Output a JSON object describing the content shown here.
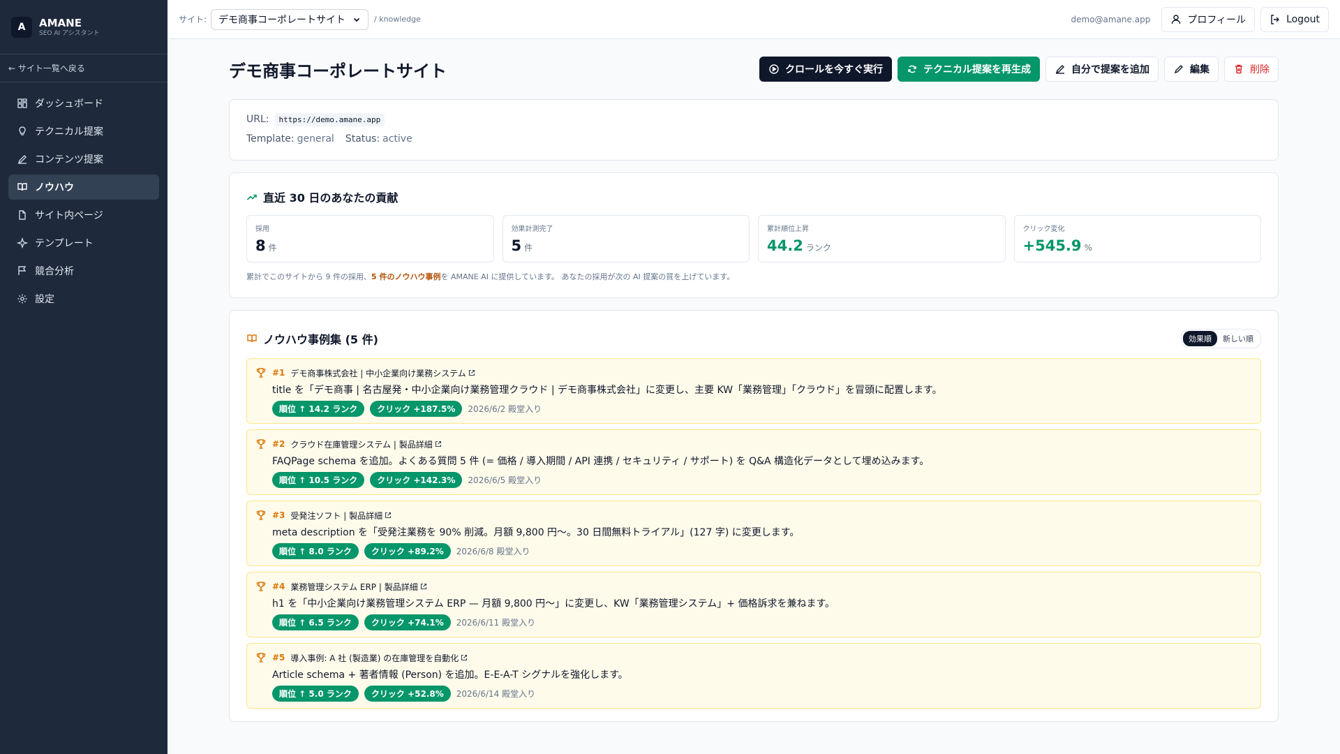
{
  "brand": {
    "logo_letter": "A",
    "name": "AMANE",
    "subtitle": "SEO AI アシスタント"
  },
  "sidebar": {
    "back_label": "← サイト一覧へ戻る",
    "items": [
      {
        "label": "ダッシュボード",
        "icon": "dashboard-icon"
      },
      {
        "label": "テクニカル提案",
        "icon": "lightbulb-icon"
      },
      {
        "label": "コンテンツ提案",
        "icon": "pen-icon"
      },
      {
        "label": "ノウハウ",
        "icon": "book-icon",
        "active": true
      },
      {
        "label": "サイト内ページ",
        "icon": "file-icon"
      },
      {
        "label": "テンプレート",
        "icon": "sparkle-icon"
      },
      {
        "label": "競合分析",
        "icon": "flag-icon"
      },
      {
        "label": "設定",
        "icon": "gear-icon"
      }
    ]
  },
  "header": {
    "site_label": "サイト:",
    "site_selected": "デモ商事コーポレートサイト",
    "breadcrumb": "/ knowledge",
    "user_email": "demo@amane.app",
    "profile_label": "プロフィール",
    "logout_label": "Logout"
  },
  "page": {
    "title": "デモ商事コーポレートサイト",
    "actions": {
      "crawl": "クロールを今すぐ実行",
      "regen": "テクニカル提案を再生成",
      "add": "自分で提案を追加",
      "edit": "編集",
      "delete": "削除"
    },
    "info": {
      "url_label": "URL:",
      "url": "https://demo.amane.app",
      "template_label": "Template:",
      "template": "general",
      "status_label": "Status:",
      "status": "active"
    }
  },
  "contribution": {
    "title": "直近 30 日のあなたの貢献",
    "stats": [
      {
        "label": "採用",
        "value": "8",
        "unit": "件"
      },
      {
        "label": "効果計測完了",
        "value": "5",
        "unit": "件"
      },
      {
        "label": "累計順位上昇",
        "value": "44.2",
        "unit": "ランク"
      },
      {
        "label": "クリック変化",
        "value": "+545.9",
        "unit": "%"
      }
    ],
    "note_pre": "累計でこのサイトから 9 件の採用、",
    "note_highlight": "5 件のノウハウ事例",
    "note_post": "を AMANE AI に提供しています。 あなたの採用が次の AI 提案の質を上げています。"
  },
  "cases": {
    "title": "ノウハウ事例集 (5 件)",
    "sort_effect": "効果順",
    "sort_new": "新しい順",
    "items": [
      {
        "num": "#1",
        "page": "デモ商事株式会社 | 中小企業向け業務システム",
        "desc": "title を「デモ商事 | 名古屋発・中小企業向け業務管理クラウド | デモ商事株式会社」に変更し、主要 KW「業務管理」「クラウド」を冒頭に配置します。",
        "rank": "順位 ↑ 14.2 ランク",
        "click": "クリック +187.5%",
        "date": "2026/6/2 殿堂入り"
      },
      {
        "num": "#2",
        "page": "クラウド在庫管理システム | 製品詳細",
        "desc": "FAQPage schema を追加。よくある質問 5 件 (= 価格 / 導入期間 / API 連携 / セキュリティ / サポート) を Q&A 構造化データとして埋め込みます。",
        "rank": "順位 ↑ 10.5 ランク",
        "click": "クリック +142.3%",
        "date": "2026/6/5 殿堂入り"
      },
      {
        "num": "#3",
        "page": "受発注ソフト | 製品詳細",
        "desc": "meta description を「受発注業務を 90% 削減。月額 9,800 円〜。30 日間無料トライアル」(127 字) に変更します。",
        "rank": "順位 ↑ 8.0 ランク",
        "click": "クリック +89.2%",
        "date": "2026/6/8 殿堂入り"
      },
      {
        "num": "#4",
        "page": "業務管理システム ERP | 製品詳細",
        "desc": "h1 を「中小企業向け業務管理システム ERP — 月額 9,800 円〜」に変更し、KW「業務管理システム」+ 価格訴求を兼ねます。",
        "rank": "順位 ↑ 6.5 ランク",
        "click": "クリック +74.1%",
        "date": "2026/6/11 殿堂入り"
      },
      {
        "num": "#5",
        "page": "導入事例: A 社 (製造業) の在庫管理を自動化",
        "desc": "Article schema + 著者情報 (Person) を追加。E-E-A-T シグナルを強化します。",
        "rank": "順位 ↑ 5.0 ランク",
        "click": "クリック +52.8%",
        "date": "2026/6/14 殿堂入り"
      }
    ]
  },
  "colors": {
    "sidebar_bg": "#1e293b",
    "accent_green": "#059669",
    "accent_amber": "#d97706",
    "danger": "#dc2626",
    "case_bg": "#fffbeb"
  }
}
